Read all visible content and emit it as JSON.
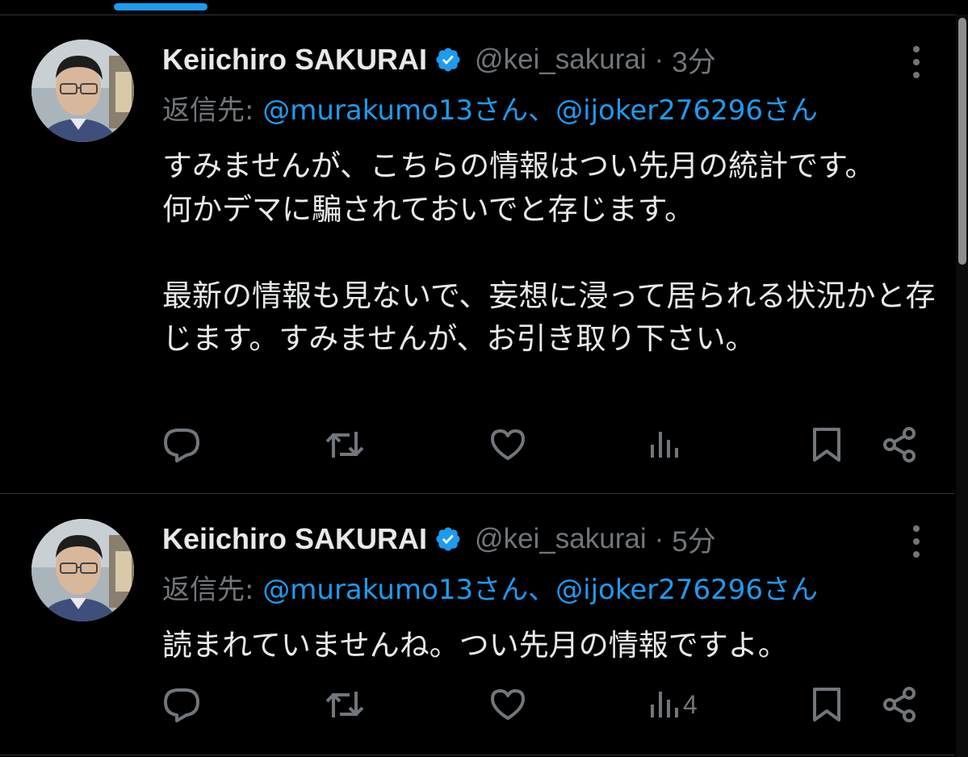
{
  "tweets": [
    {
      "author": {
        "name": "Keiichiro SAKURAI",
        "handle": "@kei_sakurai",
        "verified": true
      },
      "time": "3分",
      "reply": {
        "prefix": "返信先:",
        "mentions": [
          "@murakumo13さん",
          "@ijoker276296さん"
        ],
        "separator": "、"
      },
      "text": "すみませんが、こちらの情報はつい先月の統計です。\n何かデマに騙されておいでと存じます。\n\n最新の情報も見ないで、妄想に浸って居られる状況かと存じます。すみませんが、お引き取り下さい。",
      "views": ""
    },
    {
      "author": {
        "name": "Keiichiro SAKURAI",
        "handle": "@kei_sakurai",
        "verified": true
      },
      "time": "5分",
      "reply": {
        "prefix": "返信先:",
        "mentions": [
          "@murakumo13さん",
          "@ijoker276296さん"
        ],
        "separator": "、"
      },
      "text": "読まれていませんね。つい先月の情報ですよ。",
      "views": "4"
    }
  ],
  "icons": {
    "verified": "verified-badge-icon",
    "more": "more-vertical-icon",
    "reply": "reply-bubble-icon",
    "retweet": "retweet-icon",
    "like": "heart-icon",
    "views": "views-bar-chart-icon",
    "bookmark": "bookmark-icon",
    "share": "share-icon"
  },
  "colors": {
    "background": "#000000",
    "text": "#e7e9ea",
    "muted": "#71767b",
    "accent": "#1d9bf0"
  }
}
